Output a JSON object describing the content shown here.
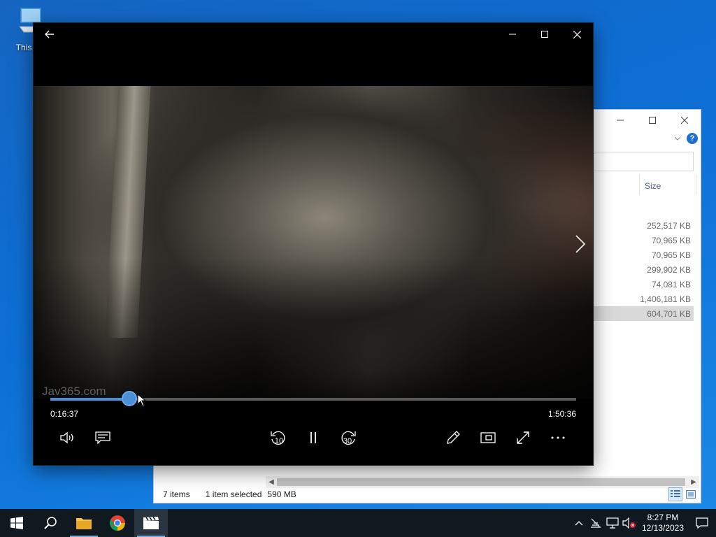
{
  "desktop": {
    "icons": [
      {
        "label": "This PC",
        "icon": "computer-icon"
      }
    ]
  },
  "player": {
    "icons": {
      "back": "arrow-left-icon",
      "minimize": "minimize-icon",
      "maximize": "maximize-icon",
      "close": "close-icon",
      "next": "chevron-right-icon",
      "volume": "volume-icon",
      "captions": "captions-icon",
      "rewind": "skip-back-10-icon",
      "pause": "pause-icon",
      "forward": "skip-forward-30-icon",
      "edit": "pencil-icon",
      "miniview": "mini-view-icon",
      "fullscreen": "fullscreen-icon",
      "more": "more-icon"
    },
    "watermark": "Jav365.com",
    "current_time": "0:16:37",
    "total_time": "1:50:36",
    "progress": 0.1502,
    "rewind_label": "10",
    "forward_label": "30",
    "accent": "#4a90d9"
  },
  "explorer": {
    "column_header": "Size",
    "sizes": [
      {
        "value": "252,517 KB",
        "selected": false
      },
      {
        "value": "70,965 KB",
        "selected": false
      },
      {
        "value": "70,965 KB",
        "selected": false
      },
      {
        "value": "299,902 KB",
        "selected": false
      },
      {
        "value": "74,081 KB",
        "selected": false
      },
      {
        "value": "1,406,181 KB",
        "selected": false
      },
      {
        "value": "604,701 KB",
        "selected": true
      }
    ],
    "status": {
      "items": "7 items",
      "selected": "1 item selected",
      "size": "590 MB"
    },
    "help_glyph": "?"
  },
  "taskbar": {
    "items": [
      {
        "name": "start",
        "icon": "windows-icon"
      },
      {
        "name": "search",
        "icon": "search-icon"
      },
      {
        "name": "file-explorer",
        "icon": "folder-icon"
      },
      {
        "name": "chrome",
        "icon": "chrome-icon"
      },
      {
        "name": "movies-tv",
        "icon": "clapperboard-icon",
        "active": true
      }
    ],
    "tray": {
      "icons": [
        "chevron-up-icon",
        "network-offline-icon",
        "ethernet-icon",
        "volume-muted-icon"
      ],
      "time": "8:27 PM",
      "date": "12/13/2023",
      "notification_icon": "notification-icon"
    }
  }
}
